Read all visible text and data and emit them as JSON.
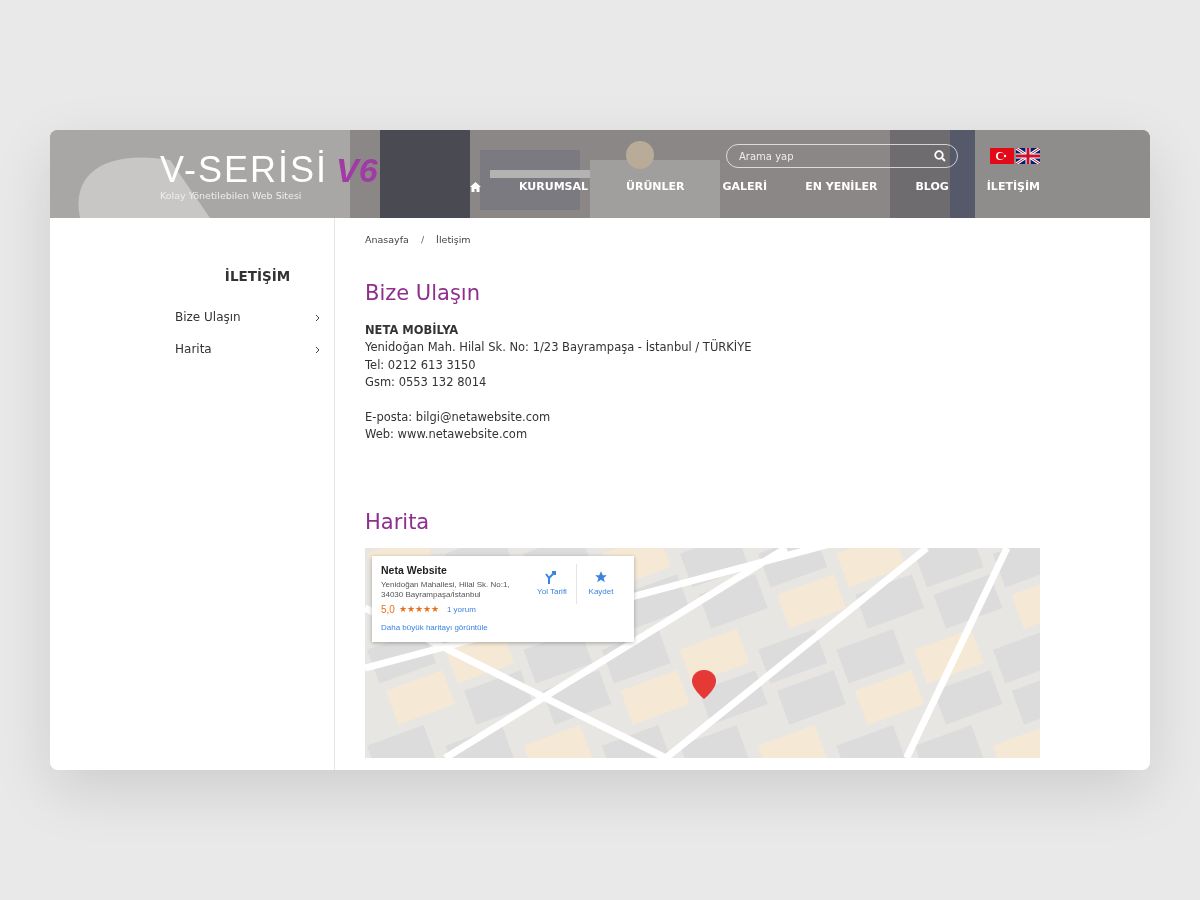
{
  "header": {
    "logo": {
      "name": "V-SERİSİ",
      "version": "V6",
      "tagline": "Kolay Yönetilebilen Web Sitesi"
    },
    "search": {
      "placeholder": "Arama yap"
    },
    "languages": [
      {
        "kind": "tr"
      },
      {
        "kind": "en"
      }
    ],
    "nav": [
      {
        "kind": "home"
      },
      {
        "kind": "text",
        "label": "KURUMSAL"
      },
      {
        "kind": "text",
        "label": "ÜRÜNLER"
      },
      {
        "kind": "text",
        "label": "GALERİ"
      },
      {
        "kind": "text",
        "label": "EN YENİLER"
      },
      {
        "kind": "text",
        "label": "BLOG"
      },
      {
        "kind": "text",
        "label": "İLETİŞİM"
      }
    ]
  },
  "sidebar": {
    "title": "İLETİŞİM",
    "items": [
      {
        "label": "Bize Ulaşın"
      },
      {
        "label": "Harita"
      }
    ]
  },
  "breadcrumb": [
    "Anasayfa",
    "İletişim"
  ],
  "breadcrumb_separator": "/",
  "contact": {
    "heading": "Bize Ulaşın",
    "company": "NETA MOBİLYA",
    "lines": [
      "Yenidoğan Mah. Hilal Sk. No: 1/23 Bayrampaşa - İstanbul / TÜRKİYE",
      "Tel: 0212 613 3150",
      "Gsm: 0553 132 8014"
    ],
    "lines_2": [
      "E-posta: bilgi@netawebsite.com",
      "Web: www.netawebsite.com"
    ]
  },
  "map": {
    "heading": "Harita",
    "card": {
      "title": "Neta Website",
      "address": "Yenidoğan Mahallesi, Hilal Sk. No:1,\n34030 Bayrampaşa/İstanbul",
      "rating": "5,0",
      "stars": 5,
      "reviews": "1 yorum",
      "link": "Daha büyük haritayı görüntüle",
      "actions": [
        {
          "kind": "directions",
          "label": "Yol Tarifi"
        },
        {
          "kind": "save",
          "label": "Kaydet"
        }
      ]
    }
  }
}
